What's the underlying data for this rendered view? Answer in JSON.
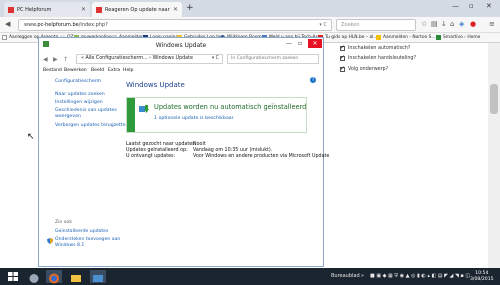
{
  "browser": {
    "tabs": [
      {
        "label": "PC Helpforum",
        "active": false
      },
      {
        "label": "Reageren Op update naar ...",
        "active": true
      }
    ],
    "url_prefix": "www.",
    "url_domain": "pc-helpforum.be",
    "url_path": "/index.php?",
    "search_placeholder": "Zoeken",
    "bookmarks": [
      "Aanleggen op Argenta...",
      "OZ",
      "mywerkonline",
      "Aanmelden",
      "Login pagina",
      "Gebruiker Log In",
      "Wijkteam Boom",
      "Meld u aan bij Tech-Ass...",
      "Tu gids op HLN.be – al...",
      "Aanmelden - Norton S...",
      "Smartivo › Home"
    ]
  },
  "page_behind": {
    "checkboxes": [
      {
        "label": "Inschakelen automatisch?",
        "checked": true
      },
      {
        "label": "Inschakelen handsleuteling?",
        "checked": true
      },
      {
        "label": "Volg onderwerp?",
        "checked": true
      }
    ]
  },
  "window": {
    "title": "Windows Update",
    "breadcrumb": "« Alle Configuratiescherm...  ›  Windows Update",
    "search_placeholder": "In Configuratiescherm zoeken",
    "menu": [
      "Bestand",
      "Bewerken",
      "Beeld",
      "Extra",
      "Help"
    ],
    "sidebar": {
      "home": "Configuratiescherm",
      "links": [
        "Naar updates zoeken",
        "Instellingen wijzigen",
        "Geschiedenis van updates weergeven",
        "Verborgen updates terugzetten"
      ],
      "see_also": "Zie ook",
      "bottom_links": [
        "Geinstalleerde updates",
        "Ondersteken toevoegen aan Windows 8.1"
      ]
    },
    "main": {
      "heading": "Windows Update",
      "status_title": "Updates worden nu automatisch geïnstalleerd",
      "status_sub": "1 optionele update is beschikbaar",
      "info": [
        {
          "key": "Laatst gezocht naar updates:",
          "value": "Nooit"
        },
        {
          "key": "Updates geïnstalleerd op:",
          "value": "Vandaag om 10:35 uur (mislukt)."
        },
        {
          "key": "U ontvangt updates:",
          "value": "Voor Windows en andere producten via Microsoft Update"
        }
      ]
    }
  },
  "taskbar": {
    "tray_label": "Bureaublad",
    "clock_time": "10:54",
    "clock_date": "3/08/2015"
  },
  "colors": {
    "accent_green": "#2e9a3a",
    "link_blue": "#1a5fb4",
    "close_red": "#e81123",
    "taskbar": "#1b2530"
  }
}
